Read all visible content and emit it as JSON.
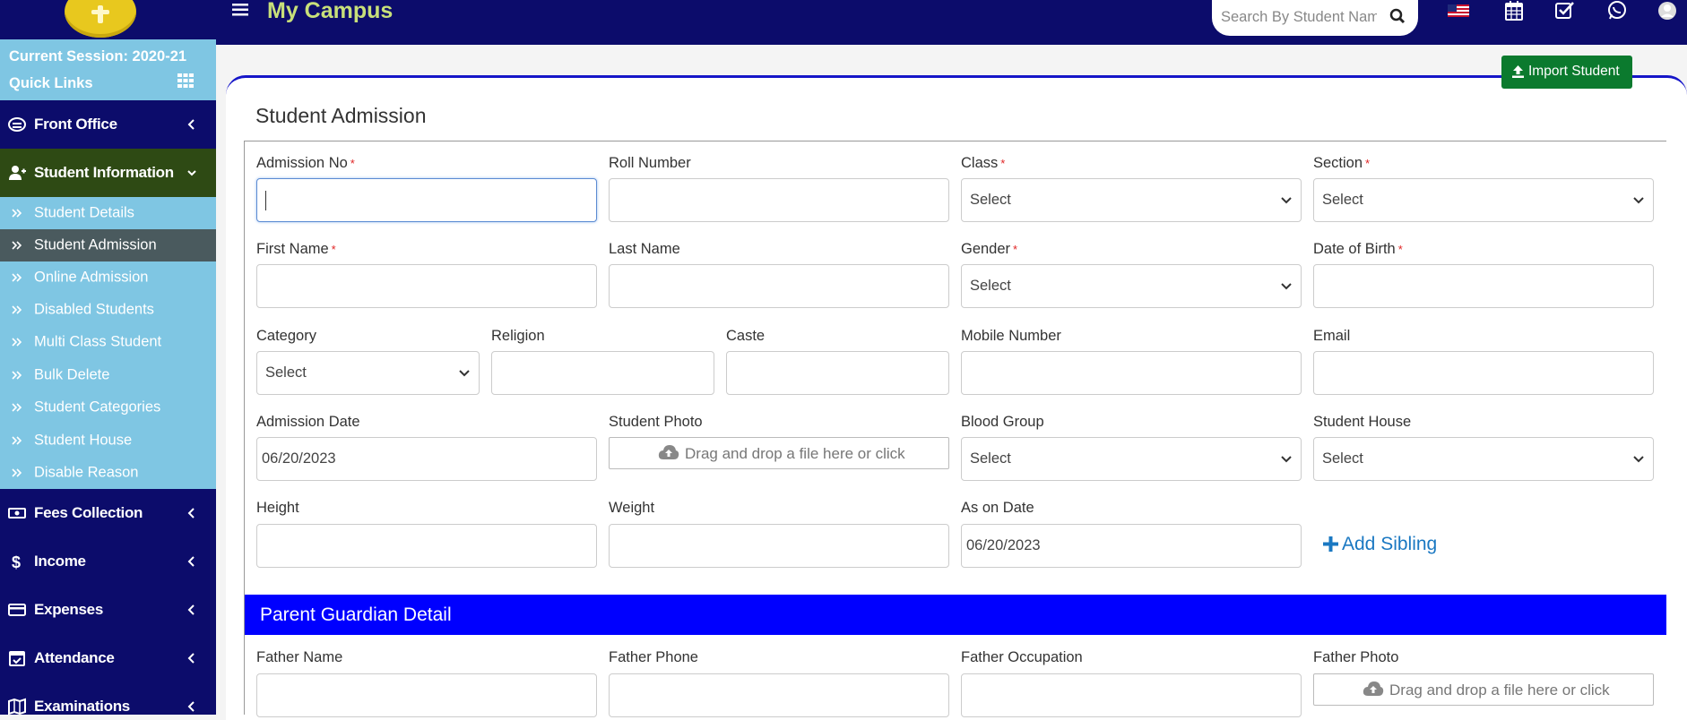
{
  "sidebar": {
    "session": "Current Session: 2020-21",
    "quick_links": "Quick Links",
    "nav": [
      {
        "label": "Front Office",
        "icon": "front-office-icon"
      },
      {
        "label": "Student Information",
        "icon": "user-plus-icon"
      },
      {
        "label": "Fees Collection",
        "icon": "money-icon"
      },
      {
        "label": "Income",
        "icon": "dollar-icon"
      },
      {
        "label": "Expenses",
        "icon": "credit-card-icon"
      },
      {
        "label": "Attendance",
        "icon": "calendar-check-icon"
      },
      {
        "label": "Examinations",
        "icon": "map-icon"
      }
    ],
    "sub_items": [
      "Student Details",
      "Student Admission",
      "Online Admission",
      "Disabled Students",
      "Multi Class Student",
      "Bulk Delete",
      "Student Categories",
      "Student House",
      "Disable Reason"
    ],
    "active_sub": "Student Admission",
    "colors": {
      "nav_bg": "#0c0c6b",
      "sub_bg": "#7fc6e3",
      "student_info_bg": "#2e4a14",
      "active_sub_bg": "#4a5a5e"
    }
  },
  "header": {
    "brand": "My Campus",
    "search_placeholder": "Search By Student Name",
    "icons": [
      "flag-us-icon",
      "calendar-icon",
      "task-check-icon",
      "whatsapp-icon",
      "user-avatar-icon"
    ]
  },
  "page": {
    "import_button": "Import Student",
    "title": "Student Admission",
    "section_parent": "Parent Guardian Detail",
    "add_sibling": "Add Sibling"
  },
  "form": {
    "admission_no": {
      "label": "Admission No",
      "value": ""
    },
    "roll_number": {
      "label": "Roll Number",
      "value": ""
    },
    "class": {
      "label": "Class",
      "value": "Select"
    },
    "section": {
      "label": "Section",
      "value": "Select"
    },
    "first_name": {
      "label": "First Name",
      "value": ""
    },
    "last_name": {
      "label": "Last Name",
      "value": ""
    },
    "gender": {
      "label": "Gender",
      "value": "Select"
    },
    "dob": {
      "label": "Date of Birth",
      "value": ""
    },
    "category": {
      "label": "Category",
      "value": "Select"
    },
    "religion": {
      "label": "Religion",
      "value": ""
    },
    "caste": {
      "label": "Caste",
      "value": ""
    },
    "mobile": {
      "label": "Mobile Number",
      "value": ""
    },
    "email": {
      "label": "Email",
      "value": ""
    },
    "admission_date": {
      "label": "Admission Date",
      "value": "06/20/2023"
    },
    "student_photo": {
      "label": "Student Photo",
      "drop_text": "Drag and drop a file here or click"
    },
    "blood_group": {
      "label": "Blood Group",
      "value": "Select"
    },
    "student_house": {
      "label": "Student House",
      "value": "Select"
    },
    "height": {
      "label": "Height",
      "value": ""
    },
    "weight": {
      "label": "Weight",
      "value": ""
    },
    "as_on_date": {
      "label": "As on Date",
      "value": "06/20/2023"
    },
    "father_name": {
      "label": "Father Name",
      "value": ""
    },
    "father_phone": {
      "label": "Father Phone",
      "value": ""
    },
    "father_occupation": {
      "label": "Father Occupation",
      "value": ""
    },
    "father_photo": {
      "label": "Father Photo",
      "drop_text": "Drag and drop a file here or click"
    },
    "required_mark": "*"
  }
}
